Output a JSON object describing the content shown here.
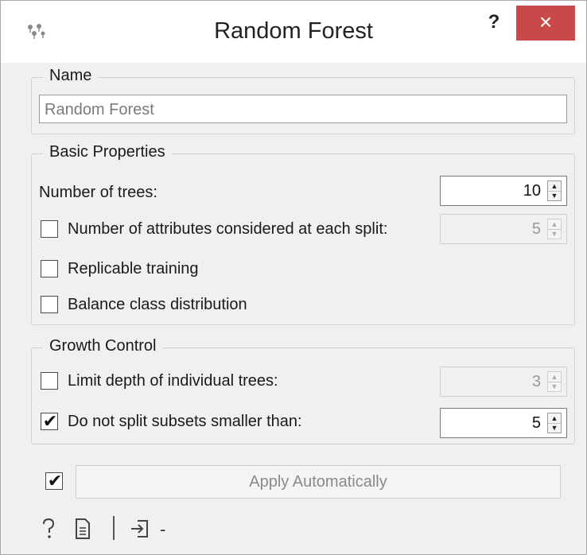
{
  "window": {
    "title": "Random Forest",
    "help_label": "?",
    "close_label": "×"
  },
  "name_group": {
    "title": "Name",
    "value": "Random Forest"
  },
  "basic": {
    "title": "Basic Properties",
    "num_trees_label": "Number of trees:",
    "num_trees_value": "10",
    "num_attrs_label": "Number of attributes considered at each split:",
    "num_attrs_checked": false,
    "num_attrs_value": "5",
    "replicable_label": "Replicable training",
    "replicable_checked": false,
    "balance_label": "Balance class distribution",
    "balance_checked": false
  },
  "growth": {
    "title": "Growth Control",
    "limit_depth_label": "Limit depth of individual trees:",
    "limit_depth_checked": false,
    "limit_depth_value": "3",
    "min_split_label": "Do not split subsets smaller than:",
    "min_split_checked": true,
    "min_split_value": "5"
  },
  "footer": {
    "auto_apply_checked": true,
    "apply_label": "Apply Automatically",
    "status_text": "-"
  },
  "icons": {
    "app": "random-forest-icon",
    "help": "question-mark-icon",
    "report": "document-icon",
    "input": "input-arrow-icon"
  },
  "colors": {
    "close_button": "#c9494b",
    "window_bg": "#f0f0f0"
  }
}
